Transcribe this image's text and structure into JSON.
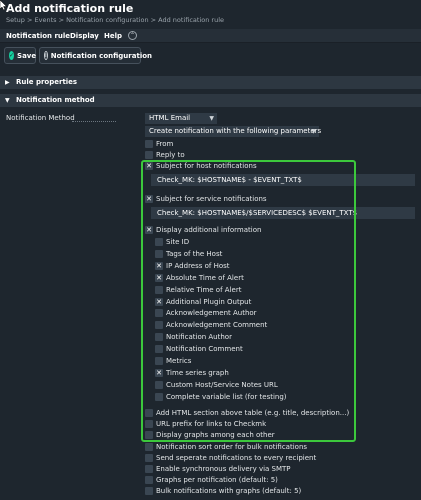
{
  "header": {
    "title": "Add notification rule",
    "breadcrumb": "Setup > Events > Notification configuration > Add notification rule"
  },
  "menu": {
    "items": [
      "Notification rule",
      "Display",
      "Help"
    ]
  },
  "toolbar": {
    "save_label": "Save",
    "notif_config_label": "Notification configuration"
  },
  "sections": {
    "rule_properties": "Rule properties",
    "notification_method": "Notification method"
  },
  "method": {
    "label": "Notification Method",
    "plugin": "HTML Email",
    "mode": "Create notification with the following parameters"
  },
  "params": {
    "from": "From",
    "reply_to": "Reply to",
    "subject_host_label": "Subject for host notifications",
    "subject_host_value": "Check_MK: $HOSTNAME$ - $EVENT_TXT$",
    "subject_service_label": "Subject for service notifications",
    "subject_service_value": "Check_MK: $HOSTNAME$/$SERVICEDESC$ $EVENT_TXT$",
    "display_info_label": "Display additional information",
    "display_items": [
      {
        "label": "Site ID",
        "checked": false
      },
      {
        "label": "Tags of the Host",
        "checked": false
      },
      {
        "label": "IP Address of Host",
        "checked": true
      },
      {
        "label": "Absolute Time of Alert",
        "checked": true
      },
      {
        "label": "Relative Time of Alert",
        "checked": false
      },
      {
        "label": "Additional Plugin Output",
        "checked": true
      },
      {
        "label": "Acknowledgement Author",
        "checked": false
      },
      {
        "label": "Acknowledgement Comment",
        "checked": false
      },
      {
        "label": "Notification Author",
        "checked": false
      },
      {
        "label": "Notification Comment",
        "checked": false
      },
      {
        "label": "Metrics",
        "checked": false
      },
      {
        "label": "Time series graph",
        "checked": true
      },
      {
        "label": "Custom Host/Service Notes URL",
        "checked": false
      },
      {
        "label": "Complete variable list (for testing)",
        "checked": false
      }
    ],
    "extra_options": [
      "Add HTML section above table (e.g. title, description...)",
      "URL prefix for links to Checkmk",
      "Display graphs among each other",
      "Notification sort order for bulk notifications",
      "Send seperate notifications to every recipient",
      "Enable synchronous delivery via SMTP",
      "Graphs per notification (default: 5)",
      "Bulk notifications with graphs (default: 5)"
    ]
  },
  "check_mark": "✕",
  "colors": {
    "background": "#1e262e",
    "highlight_border": "#3cc83c",
    "save_icon": "#15d1a0"
  }
}
